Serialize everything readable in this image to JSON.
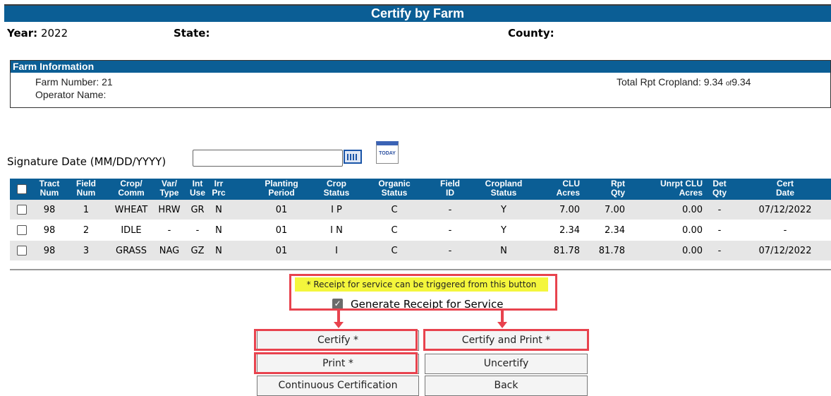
{
  "title": "Certify by Farm",
  "location": {
    "year_label": "Year:",
    "year_value": "2022",
    "state_label": "State:",
    "county_label": "County:"
  },
  "farm": {
    "header": "Farm Information",
    "farm_number": "Farm Number: 21",
    "operator_name": "Operator Name:",
    "total_prefix": "Total Rpt Cropland: 9.34",
    "total_of": "of",
    "total_value": "9.34"
  },
  "signature": {
    "label": "Signature Date (MM/DD/YYYY)",
    "value": "",
    "today_icon_text": "TODAY"
  },
  "table": {
    "headers": [
      [
        "Tract",
        "Num"
      ],
      [
        "Field",
        "Num"
      ],
      [
        "Crop/",
        "Comm"
      ],
      [
        "Var/",
        "Type"
      ],
      [
        "Int",
        "Use"
      ],
      [
        "Irr",
        "Prc"
      ],
      [
        "Planting",
        "Period"
      ],
      [
        "Crop",
        "Status"
      ],
      [
        "Organic",
        "Status"
      ],
      [
        "Field",
        "ID"
      ],
      [
        "Cropland",
        "Status"
      ],
      [
        "CLU",
        "Acres"
      ],
      [
        "Rpt",
        "Qty"
      ],
      [
        "Unrpt CLU",
        "Acres"
      ],
      [
        "Det",
        "Qty"
      ],
      [
        "Cert",
        "Date"
      ]
    ],
    "rows": [
      [
        "98",
        "1",
        "WHEAT",
        "HRW",
        "GR",
        "N",
        "01",
        "I P",
        "C",
        "-",
        "Y",
        "7.00",
        "7.00",
        "0.00",
        "-",
        "07/12/2022"
      ],
      [
        "98",
        "2",
        "IDLE",
        "-",
        "-",
        "N",
        "01",
        "I N",
        "C",
        "-",
        "Y",
        "2.34",
        "2.34",
        "0.00",
        "-",
        "-"
      ],
      [
        "98",
        "3",
        "GRASS",
        "NAG",
        "GZ",
        "N",
        "01",
        "I",
        "C",
        "-",
        "N",
        "81.78",
        "81.78",
        "0.00",
        "-",
        "07/12/2022"
      ]
    ]
  },
  "receipt": {
    "note": "* Receipt for service can be triggered from this button",
    "generate_label": "Generate Receipt for Service",
    "generate_checked": true
  },
  "buttons": {
    "certify": "Certify *",
    "certify_print": "Certify and Print *",
    "print": "Print *",
    "uncertify": "Uncertify",
    "continuous": "Continuous Certification",
    "back": "Back"
  },
  "colors": {
    "header_blue": "#0b5e95",
    "highlight": "#f4f63c",
    "annotation_red": "#e8434e"
  }
}
